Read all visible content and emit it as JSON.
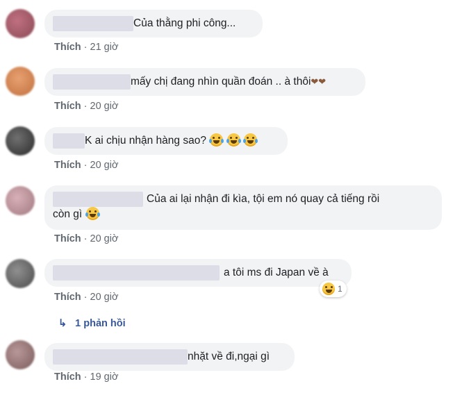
{
  "comments": [
    {
      "text": "Của thằng phi công...",
      "like": "Thích",
      "time": "21 giờ"
    },
    {
      "text": "mấy chị đang nhìn quần đoán .. à thôi",
      "like": "Thích",
      "time": "20 giờ"
    },
    {
      "text": "K ai chịu nhận hàng sao?",
      "like": "Thích",
      "time": "20 giờ"
    },
    {
      "text_line1": "Của ai lại nhận đi kìa, tội em nó quay cả tiếng rồi",
      "text_line2": "còn gì",
      "like": "Thích",
      "time": "20 giờ"
    },
    {
      "text": "a tôi ms đi Japan về à",
      "like": "Thích",
      "time": "20 giờ",
      "reaction_count": "1"
    },
    {
      "text": "nhặt về đi,ngại gì",
      "like": "Thích",
      "time": "19 giờ"
    }
  ],
  "separator": "·",
  "replies": {
    "label": "1 phản hồi"
  },
  "colors": {
    "bubble": "#f2f3f5",
    "meta": "#606770",
    "link": "#385898"
  }
}
